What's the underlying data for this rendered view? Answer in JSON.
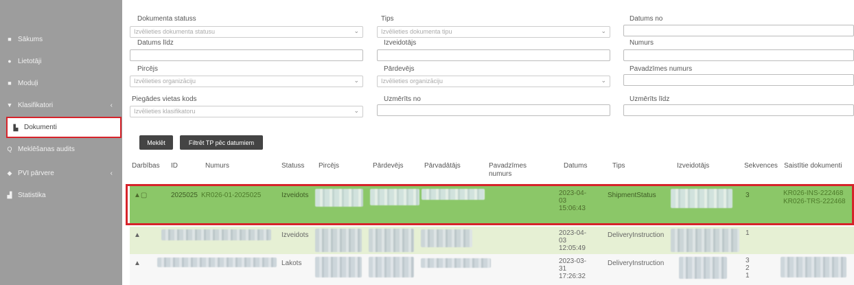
{
  "sidebar": {
    "items": [
      {
        "label": "Sākums",
        "icon": "home-icon"
      },
      {
        "label": "Lietotāji",
        "icon": "users-icon"
      },
      {
        "label": "Moduļi",
        "icon": "modules-icon"
      },
      {
        "label": "Klasifikatori",
        "icon": "filter-icon"
      },
      {
        "label": "Dokumenti",
        "icon": "document-icon"
      },
      {
        "label": "Meklēšanas audits",
        "icon": "search-icon"
      },
      {
        "label": "PVI pārvere",
        "icon": "tag-icon"
      },
      {
        "label": "Statistika",
        "icon": "chart-icon"
      }
    ]
  },
  "filters": {
    "dokumenta_statuss": {
      "label": "Dokumenta statuss",
      "placeholder": "Izvēlieties dokumenta statusu"
    },
    "tips": {
      "label": "Tips",
      "placeholder": "Izvēlieties dokumenta tipu"
    },
    "datums_no": {
      "label": "Datums no"
    },
    "datums_lidz": {
      "label": "Datums līdz"
    },
    "izveidotajs": {
      "label": "Izveidotājs"
    },
    "numurs": {
      "label": "Numurs"
    },
    "pircejs": {
      "label": "Pircējs",
      "placeholder": "Izvēlieties organizāciju"
    },
    "pardevejs": {
      "label": "Pārdevējs",
      "placeholder": "Izvēlieties organizāciju"
    },
    "pavadzimes_numurs": {
      "label": "Pavadzīmes numurs"
    },
    "piegades_vietas_kods": {
      "label": "Piegādes vietas kods",
      "placeholder": "Izvēlieties klasifikatoru"
    },
    "uzmerits_no": {
      "label": "Uzmērīts no"
    },
    "uzmerits_lidz": {
      "label": "Uzmērīts līdz"
    }
  },
  "buttons": {
    "search": "Meklēt",
    "filter_tp": "Filtrēt TP pēc datumiem"
  },
  "table": {
    "headers": [
      "Darbības",
      "ID",
      "Numurs",
      "Statuss",
      "Pircējs",
      "Pārdevējs",
      "Pārvadātājs",
      "Pavadzīmes numurs",
      "Datums",
      "Tips",
      "Izveidotājs",
      "Sekvences",
      "Saistītie dokumenti"
    ],
    "rows": [
      {
        "id": "2025025",
        "numurs": "KR026-01-2025025",
        "statuss": "Izveidots",
        "datums": "2023-04-03 15:06:43",
        "tips": "ShipmentStatus",
        "sekvences": "3",
        "saistitie": [
          "KR026-INS-222468",
          "KR026-TRS-222468"
        ]
      },
      {
        "id": "",
        "numurs": "",
        "statuss": "Izveidots",
        "datums": "2023-04-03 12:05:49",
        "tips": "DeliveryInstruction",
        "sekvences": "1",
        "saistitie": []
      },
      {
        "id": "",
        "numurs": "",
        "statuss": "Lakots",
        "datums": "2023-03-31 17:26:32",
        "tips": "DeliveryInstruction",
        "sekvences": "3\n2\n1",
        "saistitie": []
      }
    ]
  }
}
